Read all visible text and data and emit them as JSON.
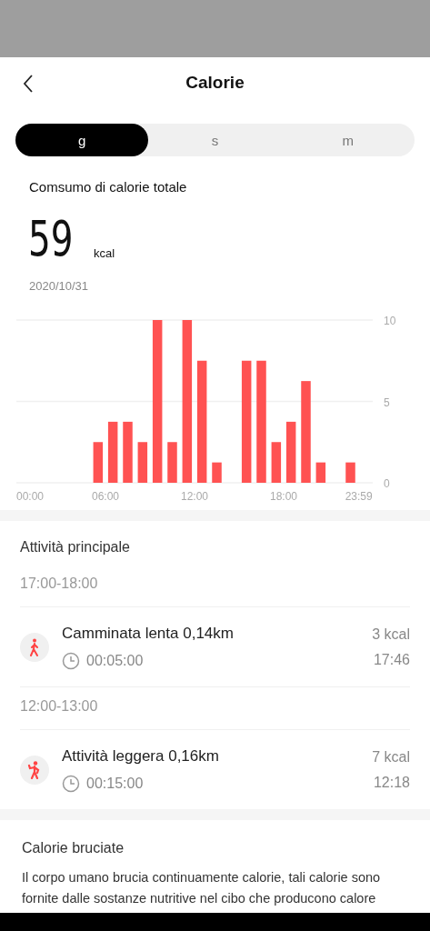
{
  "header": {
    "title": "Calorie"
  },
  "tabs": [
    {
      "label": "g",
      "selected": true
    },
    {
      "label": "s",
      "selected": false
    },
    {
      "label": "m",
      "selected": false
    }
  ],
  "summary": {
    "label": "Comsumo di calorie totale",
    "value": "59",
    "unit": "kcal",
    "date": "2020/10/31"
  },
  "chart_data": {
    "type": "bar",
    "x": [
      5.5,
      6.5,
      7.5,
      8.5,
      9.5,
      10.5,
      11.5,
      12.5,
      13.5,
      15.5,
      16.5,
      17.5,
      18.5,
      19.5,
      20.5,
      22.5
    ],
    "xlim": [
      0,
      24
    ],
    "series": [
      {
        "color": "#ff5252",
        "values": [
          2.5,
          3.75,
          3.75,
          2.5,
          10,
          2.5,
          10,
          7.5,
          1.25,
          7.5,
          7.5,
          2.5,
          3.75,
          6.25,
          1.25,
          1.25
        ]
      }
    ],
    "ylim": [
      0,
      10
    ],
    "yticks": [
      0,
      5,
      10
    ],
    "xticks": [
      {
        "value": 0,
        "label": "00:00"
      },
      {
        "value": 6,
        "label": "06:00"
      },
      {
        "value": 12,
        "label": "12:00"
      },
      {
        "value": 18,
        "label": "18:00"
      },
      {
        "value": 23.983,
        "label": "23:59"
      }
    ]
  },
  "activities": {
    "title": "Attività principale",
    "groups": [
      {
        "period": "17:00-18:00",
        "items": [
          {
            "kind": "walk",
            "name": "Camminata lenta 0,14km",
            "duration": "00:05:00",
            "calories": "3 kcal",
            "time": "17:46"
          }
        ]
      },
      {
        "period": "12:00-13:00",
        "items": [
          {
            "kind": "light",
            "name": "Attività leggera 0,16km",
            "duration": "00:15:00",
            "calories": "7 kcal",
            "time": "12:18"
          }
        ]
      }
    ]
  },
  "info": {
    "title": "Calorie bruciate",
    "text": "Il corpo umano brucia continuamente calorie, tali calorie sono fornite dalle sostanze nutritive nel cibo che producono calore"
  }
}
